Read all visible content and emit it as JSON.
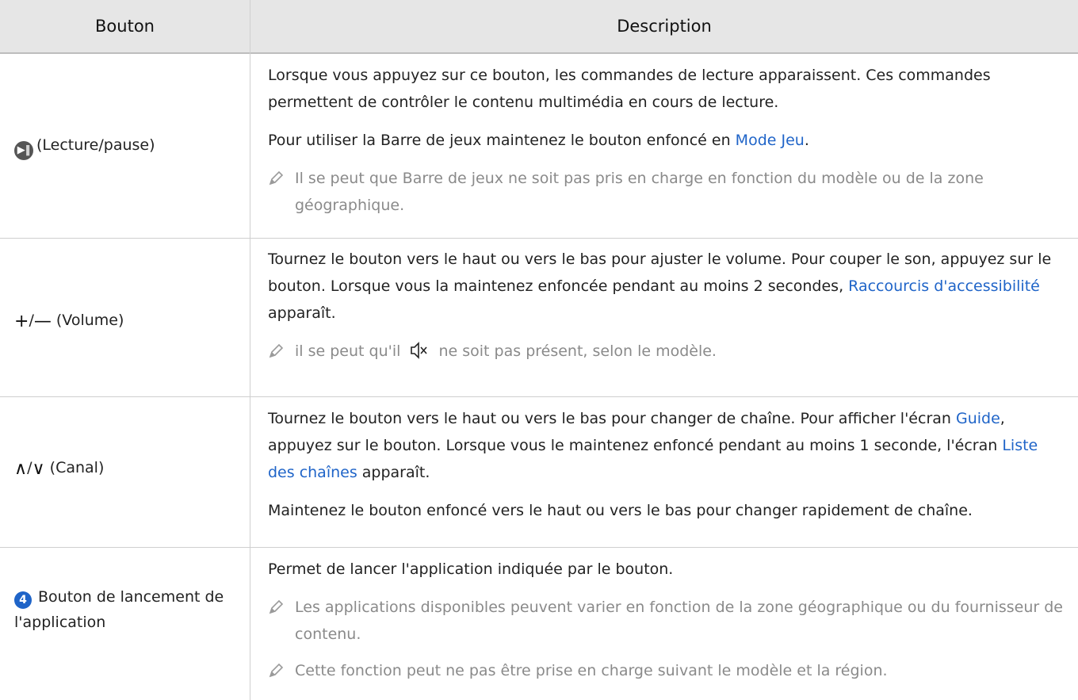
{
  "header": {
    "col1": "Bouton",
    "col2": "Description"
  },
  "rows": [
    {
      "button_label": "(Lecture/pause)",
      "icon": "play-pause-icon",
      "desc1": "Lorsque vous appuyez sur ce bouton, les commandes de lecture apparaissent. Ces commandes permettent de contrôler le contenu multimédia en cours de lecture.",
      "desc2_pre": "Pour utiliser la Barre de jeux maintenez le bouton enfoncé en ",
      "desc2_link": "Mode Jeu",
      "desc2_post": ".",
      "note1": "Il se peut que Barre de jeux ne soit pas pris en charge en fonction du modèle ou de la zone géographique."
    },
    {
      "button_label": "(Volume)",
      "icon": "plus-minus-icon",
      "plus": "+",
      "slash": "/",
      "minus": "—",
      "desc1": "Tournez le bouton vers le haut ou vers le bas pour ajuster le volume. Pour couper le son, appuyez sur le bouton. Lorsque vous la maintenez enfoncée pendant au moins 2 secondes, ",
      "desc1_link": "Raccourcis d'accessibilité",
      "desc1_post": " apparaît.",
      "note1_pre": "il se peut qu'il",
      "note1_post": "ne soit pas présent, selon le modèle."
    },
    {
      "button_label": "(Canal)",
      "icon": "chevron-up-down-icon",
      "up": "∧",
      "slash": "/",
      "down": "∨",
      "desc1_a": "Tournez le bouton vers le haut ou vers le bas pour changer de chaîne. Pour afficher l'écran ",
      "desc1_link1": "Guide",
      "desc1_b": ", appuyez sur le bouton. Lorsque vous le maintenez enfoncé pendant au moins 1 seconde, l'écran ",
      "desc1_link2": "Liste des chaînes",
      "desc1_c": " apparaît.",
      "desc2": "Maintenez le bouton enfoncé vers le haut ou vers le bas pour changer rapidement de chaîne."
    },
    {
      "button_label": "Bouton de lancement de l'application",
      "number": "4",
      "desc1": "Permet de lancer l'application indiquée par le bouton.",
      "note1": "Les applications disponibles peuvent varier en fonction de la zone géographique ou du fournisseur de contenu.",
      "note2": "Cette fonction peut ne pas être prise en charge suivant le modèle et la région."
    }
  ]
}
